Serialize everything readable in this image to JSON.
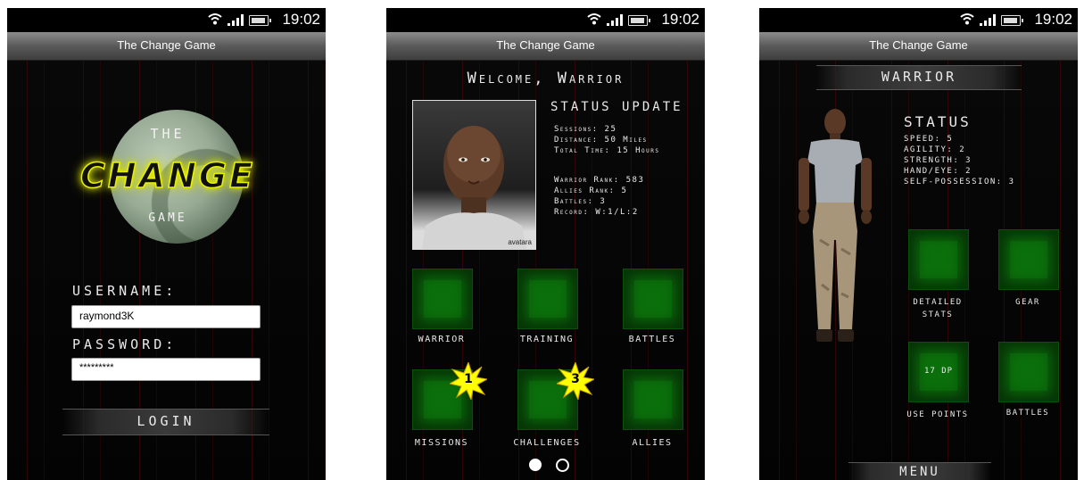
{
  "status": {
    "time": "19:02",
    "icons": [
      "wifi-icon",
      "signal-icon",
      "battery-icon"
    ]
  },
  "app_title": "The Change Game",
  "login": {
    "logo": {
      "top": "THE",
      "main": "CHANGE",
      "bottom": "GAME"
    },
    "username_label": "USERNAME:",
    "username_value": "raymond3K",
    "password_label": "PASSWORD:",
    "password_value": "*********",
    "login_label": "LOGIN"
  },
  "home": {
    "welcome": "Welcome, Warrior",
    "avatar_badge": "avatara",
    "status_title": "STATUS UPDATE",
    "stats_a": [
      "Sessions: 25",
      "Distance: 50 Miles",
      "Total Time: 15 Hours"
    ],
    "stats_b": [
      "Warrior Rank: 583",
      "Allies Rank: 5",
      "Battles: 3",
      "Record: W:1/L:2"
    ],
    "tiles": [
      {
        "label": "WARRIOR",
        "badge": ""
      },
      {
        "label": "TRAINING",
        "badge": ""
      },
      {
        "label": "BATTLES",
        "badge": ""
      },
      {
        "label": "MISSIONS",
        "badge": "1"
      },
      {
        "label": "CHALLENGES",
        "badge": "3"
      },
      {
        "label": "ALLIES",
        "badge": ""
      }
    ],
    "page_indicator": {
      "current": 1,
      "total": 2
    }
  },
  "warrior": {
    "header": "WARRIOR",
    "status_title": "STATUS",
    "stats": [
      "SPEED: 5",
      "AGILITY: 2",
      "STRENGTH: 3",
      "HAND/EYE: 2",
      "SELF-POSSESSION: 3"
    ],
    "tiles": [
      {
        "label_1": "DETAILED",
        "label_2": "STATS",
        "inner": ""
      },
      {
        "label_1": "GEAR",
        "label_2": "",
        "inner": ""
      },
      {
        "label_1": "USE POINTS",
        "label_2": "",
        "inner": "17 DP"
      },
      {
        "label_1": "BATTLES",
        "label_2": "",
        "inner": ""
      }
    ],
    "menu_label": "MENU"
  },
  "colors": {
    "tile_green": "#0a6a0a",
    "logo_yellow": "#e8f000",
    "badge_yellow": "#ffff00",
    "bg_line_red": "#5a0808"
  }
}
